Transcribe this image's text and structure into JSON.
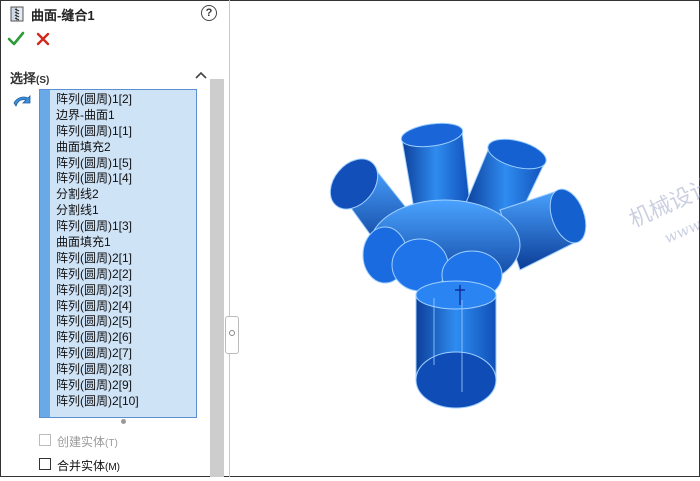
{
  "panel": {
    "title": "曲面-缝合1",
    "help_icon": "?",
    "ok_icon": "checkmark-icon",
    "cancel_icon": "x-icon",
    "section": {
      "title": "选择",
      "shortcut": "(S)",
      "items": [
        "阵列(圆周)1[2]",
        "边界-曲面1",
        "阵列(圆周)1[1]",
        "曲面填充2",
        "阵列(圆周)1[5]",
        "阵列(圆周)1[4]",
        "分割线2",
        "分割线1",
        "阵列(圆周)1[3]",
        "曲面填充1",
        "阵列(圆周)2[1]",
        "阵列(圆周)2[2]",
        "阵列(圆周)2[3]",
        "阵列(圆周)2[4]",
        "阵列(圆周)2[5]",
        "阵列(圆周)2[6]",
        "阵列(圆周)2[7]",
        "阵列(圆周)2[8]",
        "阵列(圆周)2[9]",
        "阵列(圆周)2[10]"
      ]
    },
    "options": {
      "create_solid": {
        "label": "创建实体",
        "shortcut": "(T)",
        "checked": false,
        "disabled": true
      },
      "merge_solid": {
        "label": "合并实体",
        "shortcut": "(M)",
        "checked": false,
        "disabled": false
      }
    }
  },
  "viewport": {
    "model_color": "#1e7ae6",
    "watermark": "机械设计网",
    "watermark_url": "www.jxage.com"
  }
}
